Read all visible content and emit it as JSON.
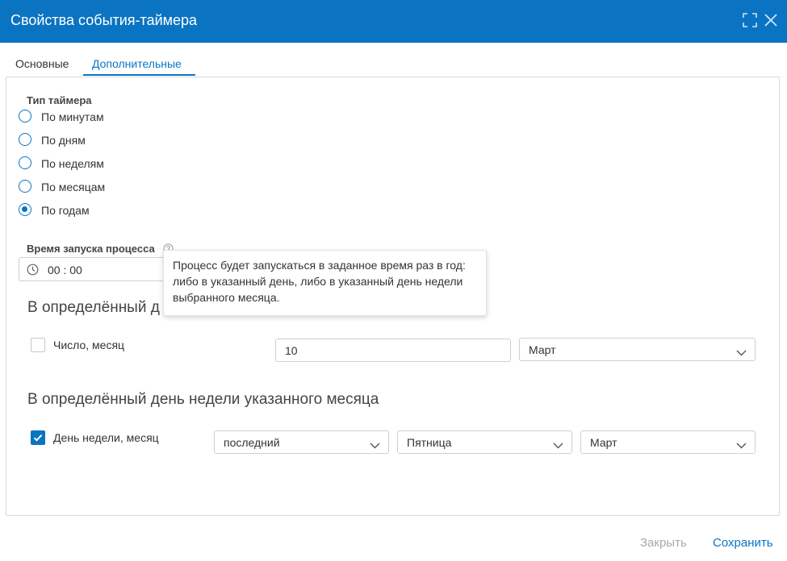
{
  "dialog": {
    "title": "Свойства события-таймера"
  },
  "tabs": [
    {
      "label": "Основные",
      "active": false
    },
    {
      "label": "Дополнительные",
      "active": true
    }
  ],
  "timer_type": {
    "label": "Тип таймера",
    "options": [
      "По минутам",
      "По дням",
      "По неделям",
      "По месяцам",
      "По годам"
    ],
    "selected": "По годам"
  },
  "start_time": {
    "label": "Время запуска процесса",
    "value": "00 : 00"
  },
  "tooltip": {
    "lines": [
      "Процесс будет запускаться в заданное время раз в год:",
      "либо в указанный день, либо в указанный день недели",
      "выбранного месяца."
    ]
  },
  "specific_day": {
    "title": "В определённый д",
    "checkbox_label": "Число, месяц",
    "checked": false,
    "day_value": "10",
    "month_value": "Март"
  },
  "specific_weekday": {
    "title": "В определённый день недели указанного месяца",
    "checkbox_label": "День недели, месяц",
    "checked": true,
    "occurrence_value": "последний",
    "weekday_value": "Пятница",
    "month_value": "Март"
  },
  "footer": {
    "close_label": "Закрыть",
    "save_label": "Сохранить"
  },
  "colors": {
    "accent": "#0a74c2",
    "disabled_text": "#a9a9a9"
  }
}
